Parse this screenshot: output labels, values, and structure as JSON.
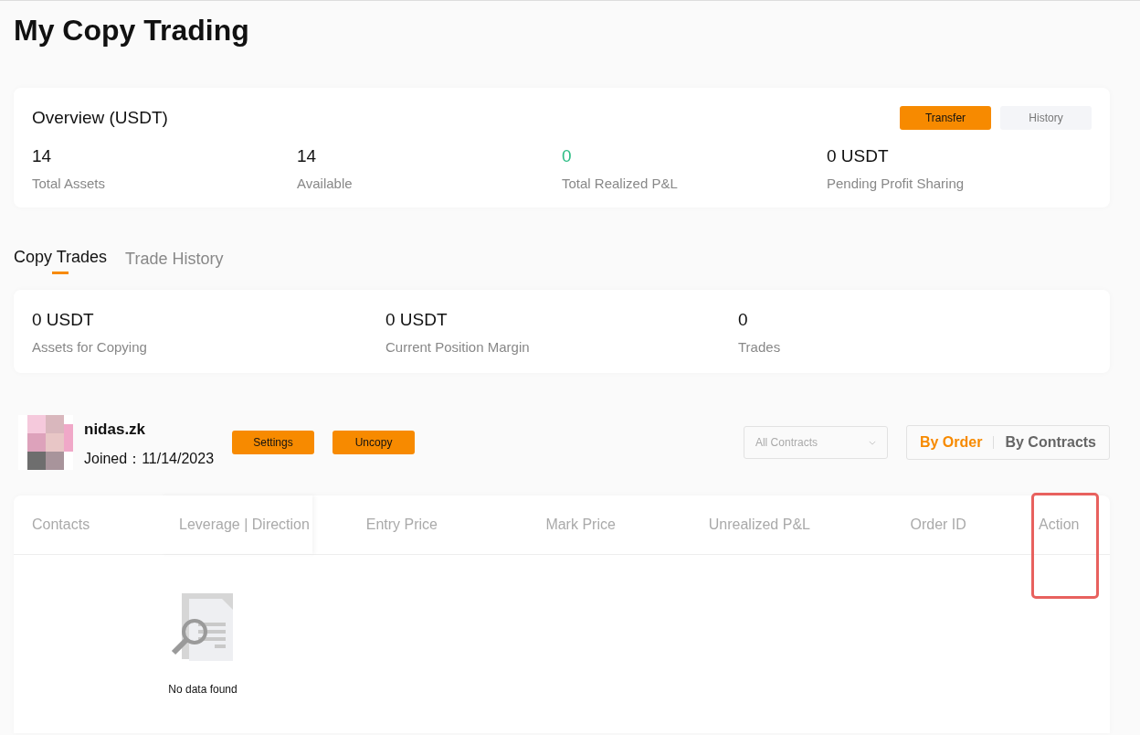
{
  "page": {
    "title": "My Copy Trading"
  },
  "overview": {
    "title": "Overview (USDT)",
    "buttons": [
      {
        "label": "Transfer",
        "kind": "primary"
      },
      {
        "label": "History",
        "kind": "secondary"
      }
    ],
    "stats": [
      {
        "value": "14",
        "label": "Total Assets",
        "positive": false
      },
      {
        "value": "14",
        "label": "Available",
        "positive": false
      },
      {
        "value": "0",
        "label": "Total Realized P&L",
        "positive": true
      },
      {
        "value": "0 USDT",
        "label": "Pending Profit Sharing",
        "positive": false
      }
    ]
  },
  "tabs": [
    {
      "label": "Copy Trades",
      "selected": true
    },
    {
      "label": "Trade History",
      "selected": false
    }
  ],
  "copy_stats": [
    {
      "value": "0 USDT",
      "label": "Assets for Copying"
    },
    {
      "value": "0 USDT",
      "label": "Current Position Margin"
    },
    {
      "value": "0",
      "label": "Trades"
    }
  ],
  "trader": {
    "name": "nidas.zk",
    "joined": "Joined：11/14/2023",
    "buttons": [
      "Settings",
      "Uncopy"
    ]
  },
  "filter": {
    "placeholder": "All Contracts"
  },
  "view_toggle": [
    {
      "label": "By Order",
      "selected": true
    },
    {
      "label": "By Contracts",
      "selected": false
    }
  ],
  "table": {
    "columns": [
      {
        "label": "Contacts",
        "highlighted": false
      },
      {
        "label": "Leverage | Direction",
        "highlighted": false
      },
      {
        "label": "Entry Price",
        "highlighted": false
      },
      {
        "label": "Mark Price",
        "highlighted": false
      },
      {
        "label": "Unrealized P&L",
        "highlighted": false
      },
      {
        "label": "Order ID",
        "highlighted": false
      },
      {
        "label": "Action",
        "highlighted": true
      }
    ],
    "empty_text": "No data found"
  }
}
